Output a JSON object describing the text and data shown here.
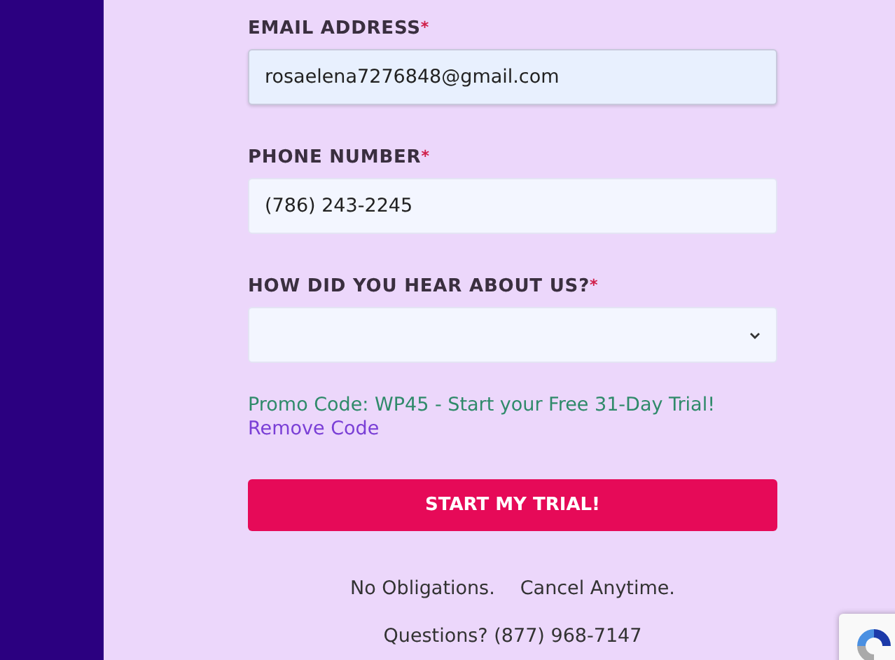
{
  "fields": [
    {
      "kind": "input",
      "label": "EMAIL ADDRESS",
      "required_mark": "*",
      "value": "rosaelena7276848@gmail.com",
      "selected": true
    },
    {
      "kind": "input",
      "label": "PHONE NUMBER",
      "required_mark": "*",
      "value": "(786) 243-2245",
      "selected": false
    },
    {
      "kind": "select",
      "label": "HOW DID YOU HEAR ABOUT US?",
      "required_mark": "*",
      "selected": false
    }
  ],
  "promo": {
    "message": "Promo Code: WP45 - Start your Free 31-Day Trial!",
    "remove_link": "Remove Code"
  },
  "submit_button": "START MY TRIAL!",
  "assurances": [
    "No Obligations.",
    "Cancel Anytime."
  ],
  "questions": "Questions? (877) 968-7147"
}
